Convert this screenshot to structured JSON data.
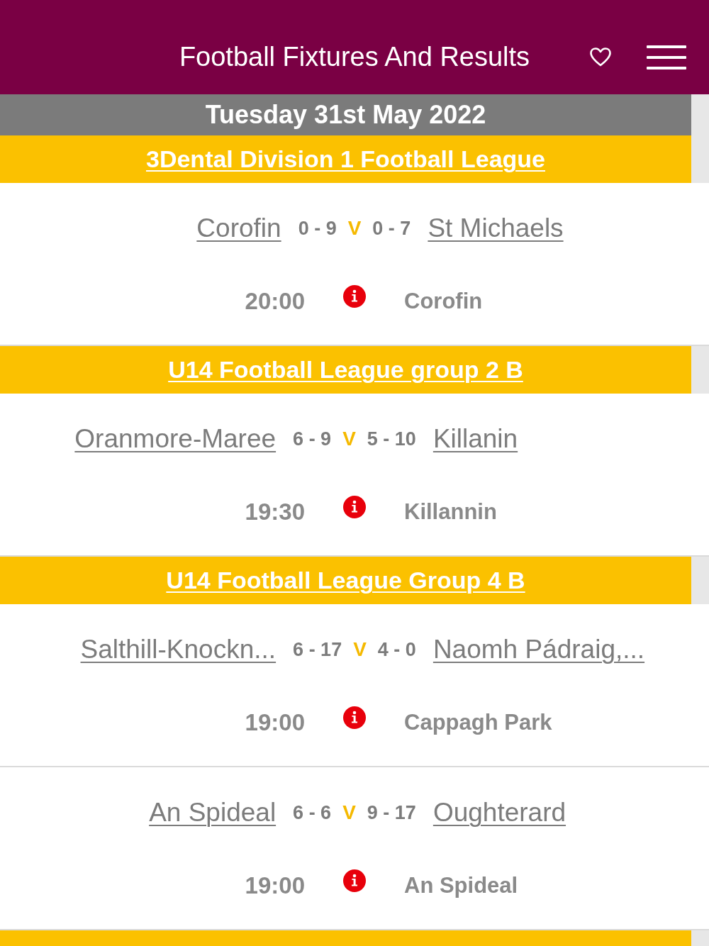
{
  "header": {
    "title": "Football Fixtures And Results"
  },
  "date": "Tuesday 31st May 2022",
  "leagues": [
    {
      "name": "3Dental Division 1 Football League",
      "fixtures": [
        {
          "home": "Corofin",
          "home_score": "0 - 9",
          "versus": "V",
          "away_score": "0 - 7",
          "away": "St Michaels",
          "time": "20:00",
          "venue": "Corofin"
        }
      ]
    },
    {
      "name": "U14 Football League group 2 B",
      "fixtures": [
        {
          "home": "Oranmore-Maree",
          "home_score": "6 - 9",
          "versus": "V",
          "away_score": "5 - 10",
          "away": "Killanin",
          "time": "19:30",
          "venue": "Killannin"
        }
      ]
    },
    {
      "name": "U14 Football League Group 4 B",
      "fixtures": [
        {
          "home": "Salthill-Knockn...",
          "home_score": "6 - 17",
          "versus": "V",
          "away_score": "4 - 0",
          "away": "Naomh Pádraig,...",
          "time": "19:00",
          "venue": "Cappagh Park"
        },
        {
          "home": "An Spideal",
          "home_score": "6 - 6",
          "versus": "V",
          "away_score": "9 - 17",
          "away": "Oughterard",
          "time": "19:00",
          "venue": "An Spideal"
        }
      ]
    }
  ]
}
